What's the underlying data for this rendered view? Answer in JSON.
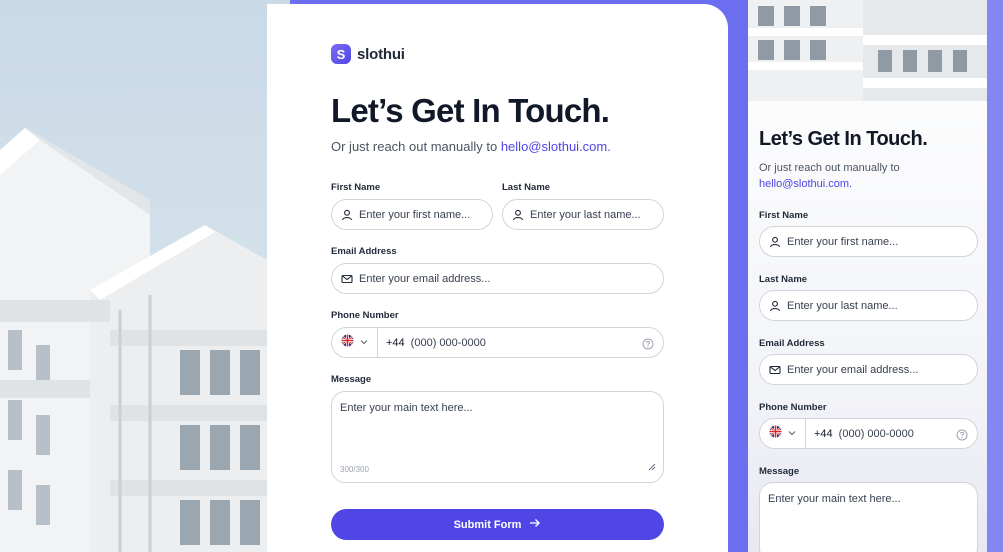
{
  "brand": {
    "name": "slothui",
    "mark": "S"
  },
  "form": {
    "title": "Let’s Get In Touch.",
    "subtitle_prefix": "Or just reach out manually to",
    "email_link": "hello@slothui.com.",
    "first_name": {
      "label": "First Name",
      "placeholder": "Enter your first name..."
    },
    "last_name": {
      "label": "Last Name",
      "placeholder": "Enter your last name..."
    },
    "email": {
      "label": "Email Address",
      "placeholder": "Enter your email address..."
    },
    "phone": {
      "label": "Phone Number",
      "country_code": "+44",
      "placeholder": "(000) 000-0000"
    },
    "message": {
      "label": "Message",
      "placeholder": "Enter your main text here...",
      "counter": "300/300"
    },
    "submit_label": "Submit Form"
  },
  "mobile": {
    "title": "Let’s Get In Touch.",
    "subtitle_line1": "Or just reach out manually to",
    "subtitle_line2": "hello@slothui.com.",
    "first_name": {
      "label": "First Name",
      "placeholder": "Enter your first name..."
    },
    "last_name": {
      "label": "Last Name",
      "placeholder": "Enter your last name..."
    },
    "email": {
      "label": "Email Address",
      "placeholder": "Enter your email address..."
    },
    "phone": {
      "label": "Phone Number",
      "country_code": "+44",
      "placeholder": "(000) 000-0000"
    },
    "message": {
      "label": "Message",
      "placeholder": "Enter your main text here..."
    }
  },
  "colors": {
    "accent": "#4f46e5",
    "background": "#6c6ef0"
  },
  "icons": [
    "user-icon",
    "mail-icon",
    "uk-flag-icon",
    "chevron-down-icon",
    "help-icon",
    "resize-handle-icon",
    "arrow-right-icon"
  ]
}
